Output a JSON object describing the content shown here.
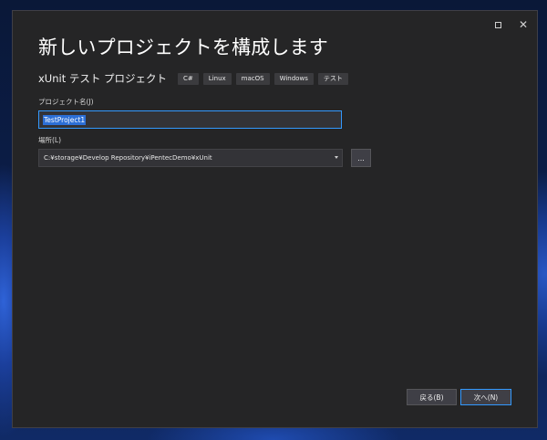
{
  "dialog": {
    "title": "新しいプロジェクトを構成します",
    "template_name": "xUnit テスト プロジェクト",
    "tags": [
      "C#",
      "Linux",
      "macOS",
      "Windows",
      "テスト"
    ],
    "project_name": {
      "label": "プロジェクト名(J)",
      "value": "TestProject1"
    },
    "location": {
      "label": "場所(L)",
      "value": "C:¥storage¥Develop Repository¥iPentecDemo¥xUnit",
      "browse_label": "..."
    },
    "buttons": {
      "back": "戻る(B)",
      "next": "次へ(N)"
    },
    "window_controls": {
      "maximize_icon": "maximize-icon",
      "close_icon": "close-icon",
      "close_glyph": "✕"
    }
  },
  "colors": {
    "dialog_bg": "#252526",
    "input_bg": "#333337",
    "focus_border": "#3399ff",
    "selection": "#2c6fd6",
    "button_bg": "#3f3f46",
    "tag_bg": "#3b3b3e"
  }
}
